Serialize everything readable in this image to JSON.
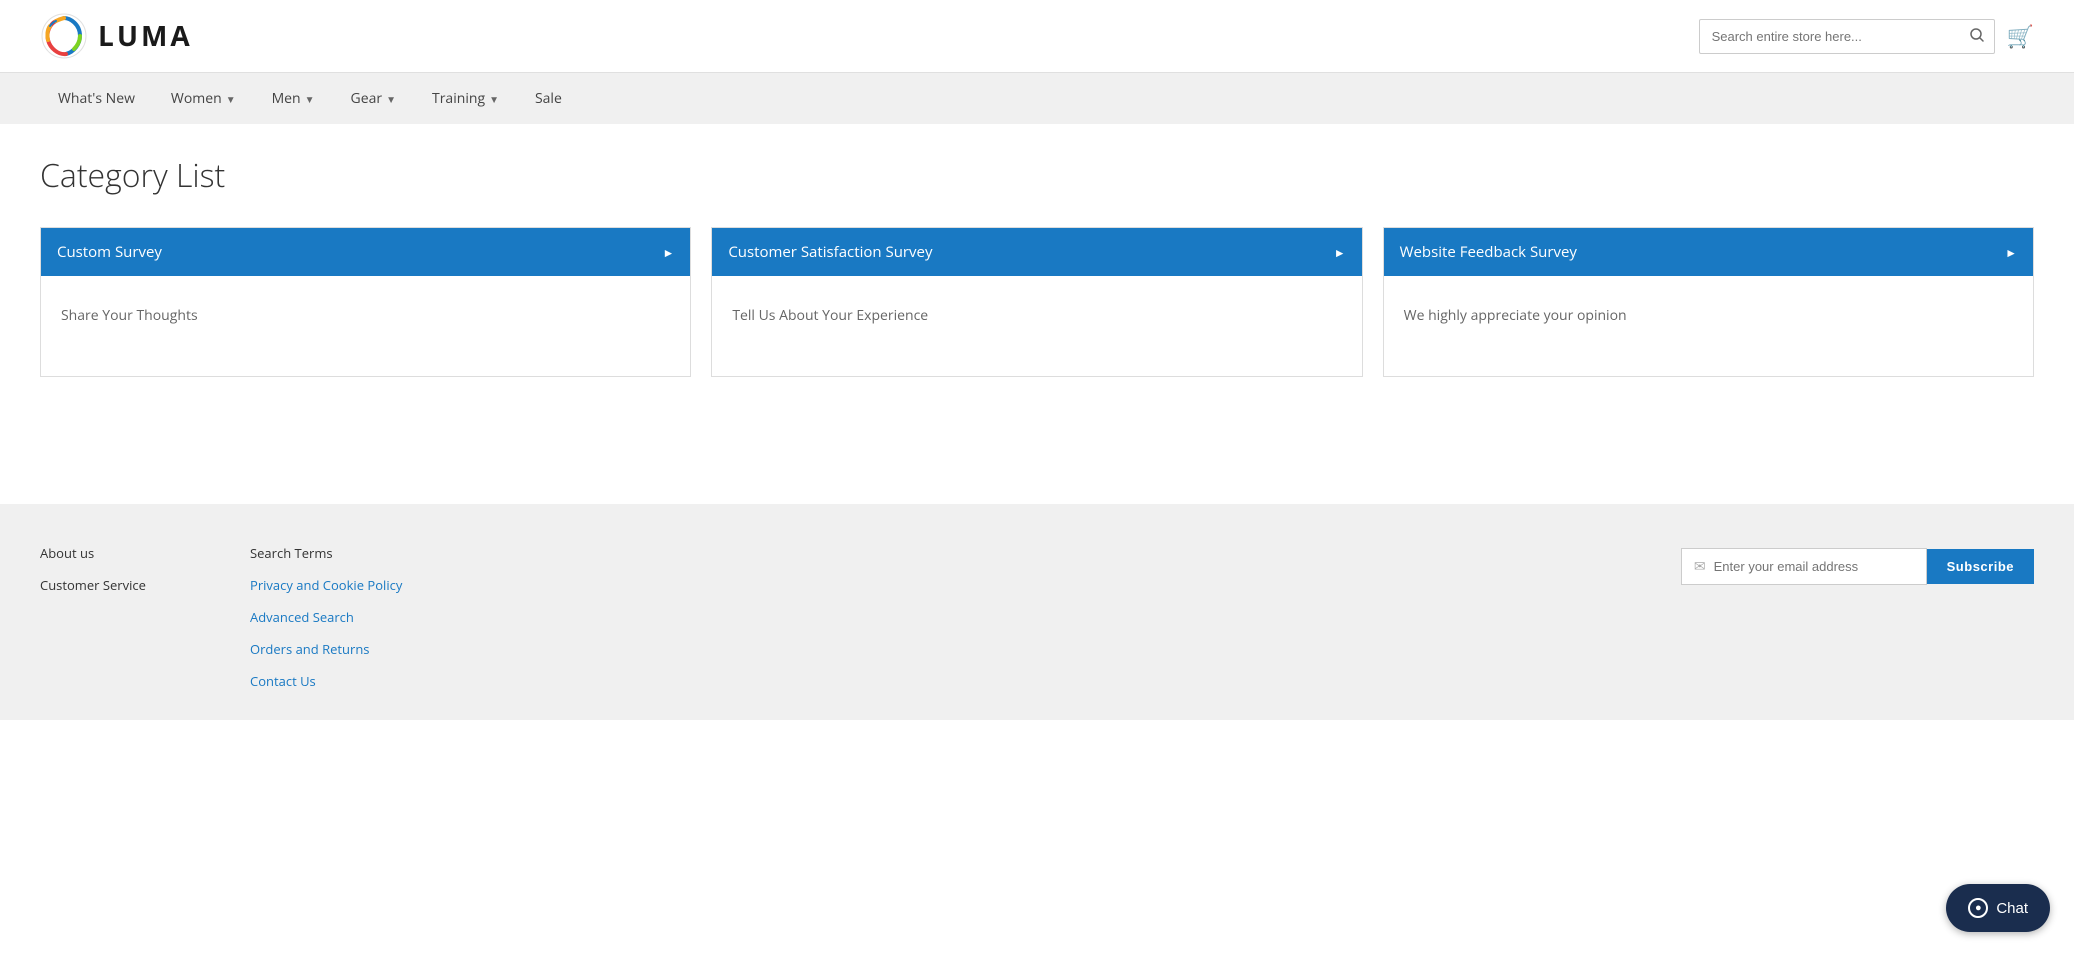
{
  "header": {
    "logo_text": "LUMA",
    "search_placeholder": "Search entire store here...",
    "cart_label": "Cart"
  },
  "nav": {
    "items": [
      {
        "label": "What's New",
        "has_dropdown": false
      },
      {
        "label": "Women",
        "has_dropdown": true
      },
      {
        "label": "Men",
        "has_dropdown": true
      },
      {
        "label": "Gear",
        "has_dropdown": true
      },
      {
        "label": "Training",
        "has_dropdown": true
      },
      {
        "label": "Sale",
        "has_dropdown": false
      }
    ]
  },
  "main": {
    "page_title": "Category List",
    "cards": [
      {
        "title": "Custom Survey",
        "description": "Share Your Thoughts"
      },
      {
        "title": "Customer Satisfaction Survey",
        "description": "Tell Us About Your Experience"
      },
      {
        "title": "Website Feedback Survey",
        "description": "We highly appreciate your opinion"
      }
    ]
  },
  "footer": {
    "col1": {
      "links": [
        {
          "label": "About us",
          "blue": false
        },
        {
          "label": "Customer Service",
          "blue": false
        }
      ]
    },
    "col2": {
      "links": [
        {
          "label": "Search Terms",
          "blue": false
        },
        {
          "label": "Privacy and Cookie Policy",
          "blue": true
        },
        {
          "label": "Advanced Search",
          "blue": true
        },
        {
          "label": "Orders and Returns",
          "blue": true
        },
        {
          "label": "Contact Us",
          "blue": true
        }
      ]
    },
    "newsletter": {
      "input_placeholder": "Enter your email address",
      "button_label": "Subscribe"
    }
  },
  "chat": {
    "label": "Chat"
  }
}
